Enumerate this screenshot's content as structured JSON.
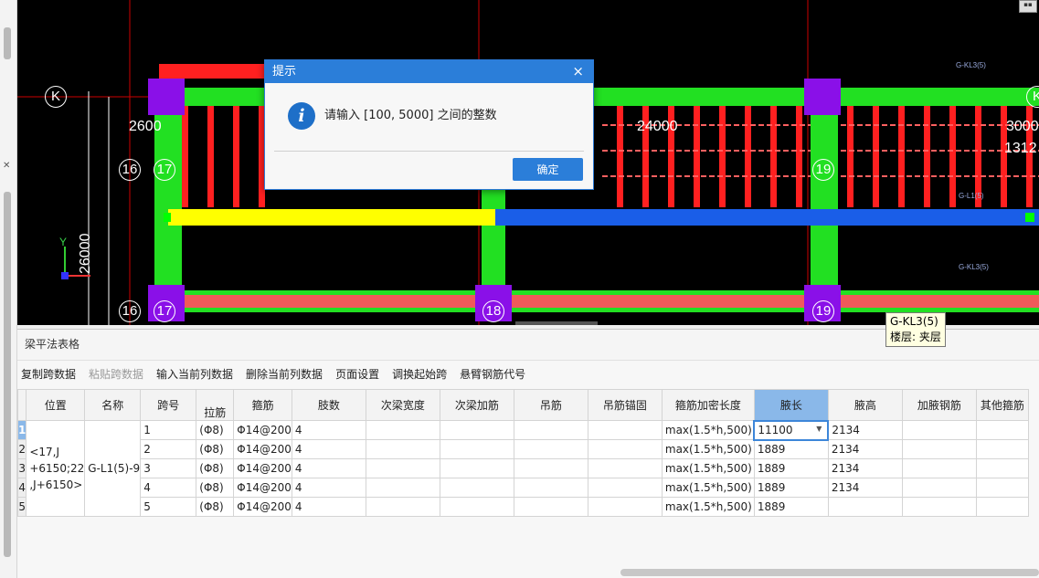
{
  "cad": {
    "axis_labels": [
      "K",
      "K",
      "16",
      "17",
      "19",
      "16",
      "17",
      "18",
      "19"
    ],
    "dimensions": [
      "2600",
      "24000",
      "3000",
      "1312",
      "26000"
    ],
    "axis_indicator": {
      "y": "Y"
    },
    "tooltip": {
      "line1": "G-KL3(5)",
      "line2": "楼层: 夹层"
    },
    "beam_tags": [
      "G-KL3(5)",
      "G-L1(5)",
      "G-KL3(5)"
    ]
  },
  "dialog": {
    "title": "提示",
    "message": "请输入 [100, 5000] 之间的整数",
    "ok_label": "确定",
    "close_label": "×",
    "icon_glyph": "i"
  },
  "panel": {
    "title": "梁平法表格",
    "toolbar": [
      {
        "label": "复制跨数据",
        "enabled": true
      },
      {
        "label": "粘贴跨数据",
        "enabled": false
      },
      {
        "label": "输入当前列数据",
        "enabled": true
      },
      {
        "label": "删除当前列数据",
        "enabled": true
      },
      {
        "label": "页面设置",
        "enabled": true
      },
      {
        "label": "调换起始跨",
        "enabled": true
      },
      {
        "label": "悬臂钢筋代号",
        "enabled": true
      }
    ]
  },
  "table": {
    "headers": [
      "位置",
      "名称",
      "跨号",
      "拉筋",
      "箍筋",
      "肢数",
      "次梁宽度",
      "次梁加筋",
      "吊筋",
      "吊筋锚固",
      "箍筋加密长度",
      "腋长",
      "腋高",
      "加腋钢筋",
      "其他箍筋"
    ],
    "selected_header": "腋长",
    "position": "<17,J +6150;22 ,J+6150>",
    "name": "G-L1(5)-9",
    "rows": [
      {
        "num": "1",
        "span": "1",
        "tie": "(Φ8)",
        "stirrup": "Φ14@200",
        "legs": "4",
        "densify": "max(1.5*h,500)",
        "haunch_len": "11100",
        "haunch_h": "2134"
      },
      {
        "num": "2",
        "span": "2",
        "tie": "(Φ8)",
        "stirrup": "Φ14@200",
        "legs": "4",
        "densify": "max(1.5*h,500)",
        "haunch_len": "1889",
        "haunch_h": "2134"
      },
      {
        "num": "3",
        "span": "3",
        "tie": "(Φ8)",
        "stirrup": "Φ14@200",
        "legs": "4",
        "densify": "max(1.5*h,500)",
        "haunch_len": "1889",
        "haunch_h": "2134"
      },
      {
        "num": "4",
        "span": "4",
        "tie": "(Φ8)",
        "stirrup": "Φ14@200",
        "legs": "4",
        "densify": "max(1.5*h,500)",
        "haunch_len": "1889",
        "haunch_h": "2134"
      },
      {
        "num": "5",
        "span": "5",
        "tie": "(Φ8)",
        "stirrup": "Φ14@200",
        "legs": "4",
        "densify": "max(1.5*h,500)",
        "haunch_len": "1889",
        "haunch_h": ""
      }
    ]
  },
  "colors": {
    "dialog_blue": "#2b7ed9",
    "beam_green": "#22e022",
    "beam_red": "#ff2020",
    "column_purple": "#8a10e8",
    "highlight_yellow": "#ffff00",
    "selected_blue": "#1a5ee8"
  }
}
